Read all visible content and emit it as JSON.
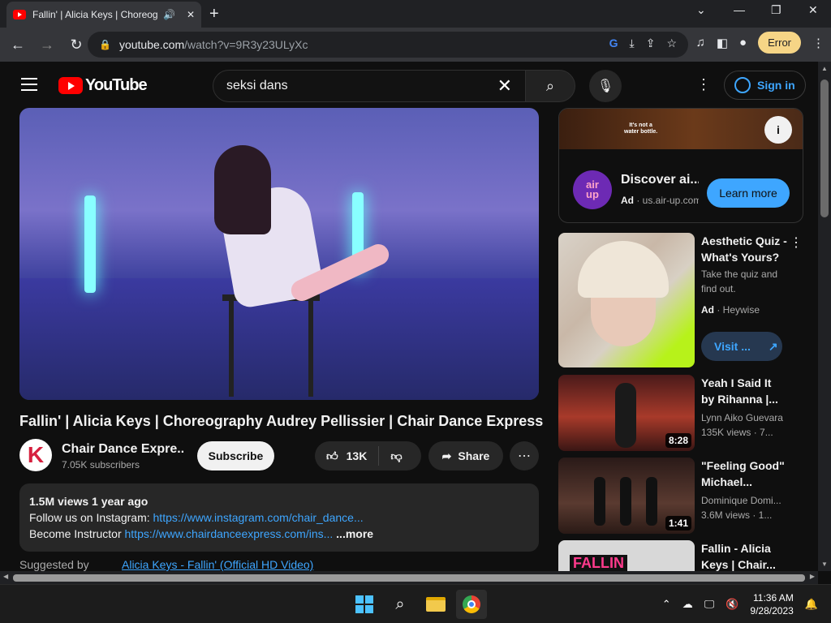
{
  "browser": {
    "tab_title": "Fallin' | Alicia Keys | Choreog",
    "url_host": "youtube.com",
    "url_path": "/watch?v=9R3y23ULyXc",
    "error_label": "Error"
  },
  "youtube": {
    "logo_text": "YouTube",
    "search_value": "seksi dans",
    "signin_label": "Sign in"
  },
  "video": {
    "title": "Fallin' | Alicia Keys | Choreography Audrey Pellissier | Chair Dance Express",
    "channel_name": "Chair Dance Expre...",
    "subscribers": "7.05K subscribers",
    "subscribe_label": "Subscribe",
    "likes": "13K",
    "share_label": "Share",
    "description": {
      "meta": "1.5M views  1 year ago",
      "line1_prefix": "Follow us on Instagram: ",
      "line1_link": "https://www.instagram.com/chair_dance...",
      "line2_prefix": "Become Instructor ",
      "line2_link": "https://www.chairdanceexpress.com/ins...",
      "more_label": " ...more"
    },
    "suggested_label": "Suggested by",
    "suggested_link": "Alicia Keys - Fallin' (Official HD Video)"
  },
  "ad_card": {
    "banner_text_1": "It's not a",
    "banner_text_2": "water bottle.",
    "logo_text_1": "air",
    "logo_text_2": "up",
    "title": "Discover ai...",
    "ad_label": "Ad",
    "ad_domain": " · us.air-up.com",
    "cta": "Learn more"
  },
  "recommendations": [
    {
      "title": "Aesthetic Quiz - What's Yours?",
      "line1": "Take the quiz and",
      "line2": "find out.",
      "ad_label": "Ad",
      "advertiser": " · Heywise",
      "cta": "Visit ..."
    },
    {
      "title": "Yeah I Said It by Rihanna |...",
      "channel": "Lynn Aiko Guevara",
      "views": "135K views · 7...",
      "duration": "8:28"
    },
    {
      "title": "\"Feeling Good\" Michael...",
      "channel": "Dominique Domi...",
      "views": "3.6M views · 1...",
      "duration": "1:41"
    },
    {
      "title": "Fallin - Alicia Keys | Chair...",
      "thumb_text": "FALLIN"
    }
  ],
  "taskbar": {
    "time": "11:36 AM",
    "date": "9/28/2023"
  },
  "colors": {
    "youtube_red": "#ff0000",
    "link_blue": "#3ea6ff",
    "background": "#0f0f0f",
    "airup_purple": "#6d2ab4"
  }
}
